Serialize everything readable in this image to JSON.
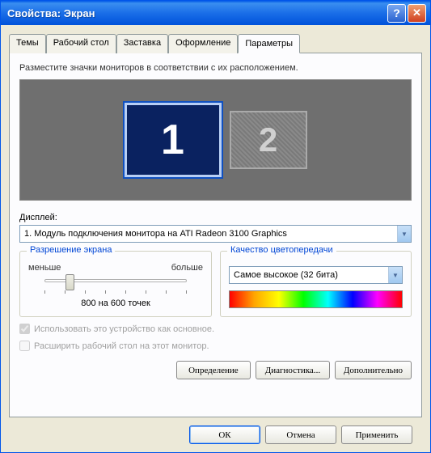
{
  "titlebar": {
    "title": "Свойства: Экран"
  },
  "tabs": {
    "themes": "Темы",
    "desktop": "Рабочий стол",
    "screensaver": "Заставка",
    "appearance": "Оформление",
    "settings": "Параметры"
  },
  "instruction": "Разместите значки мониторов в соответствии с их расположением.",
  "monitors": {
    "m1": "1",
    "m2": "2"
  },
  "display": {
    "label": "Дисплей:",
    "value": "1. Модуль подключения монитора на ATI Radeon 3100 Graphics"
  },
  "resolution": {
    "title": "Разрешение экрана",
    "less": "меньше",
    "more": "больше",
    "value": "800 на 600 точек"
  },
  "quality": {
    "title": "Качество цветопередачи",
    "value": "Самое высокое (32 бита)"
  },
  "checks": {
    "primary": "Использовать это устройство как основное.",
    "extend": "Расширить рабочий стол на этот монитор."
  },
  "buttons": {
    "identify": "Определение",
    "troubleshoot": "Диагностика...",
    "advanced": "Дополнительно"
  },
  "dialog": {
    "ok": "ОК",
    "cancel": "Отмена",
    "apply": "Применить"
  }
}
